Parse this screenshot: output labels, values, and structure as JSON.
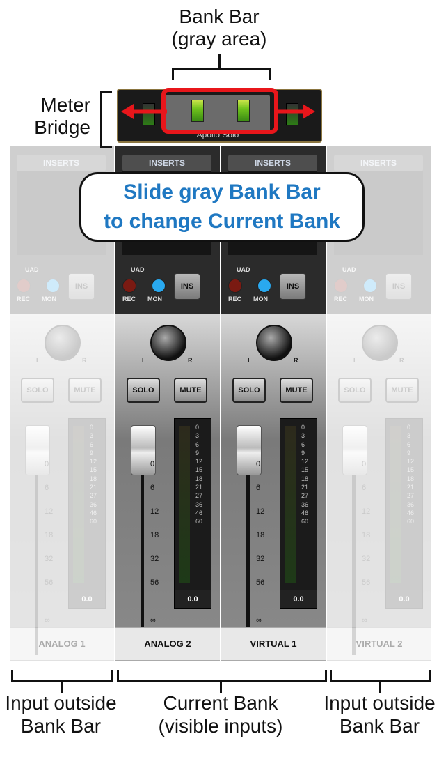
{
  "annotations": {
    "bank_bar_title": "Bank Bar",
    "bank_bar_subtitle": "(gray area)",
    "meter_bridge_line1": "Meter",
    "meter_bridge_line2": "Bridge",
    "callout_line1": "Slide gray Bank Bar",
    "callout_line2": "to change Current Bank",
    "outside_left_line1": "Input outside",
    "outside_left_line2": "Bank Bar",
    "current_bank_line1": "Current Bank",
    "current_bank_line2": "(visible inputs)",
    "outside_right_line1": "Input outside",
    "outside_right_line2": "Bank Bar"
  },
  "meter_bridge": {
    "label": "Apollo Solo"
  },
  "strip_common": {
    "inserts_label": "INSERTS",
    "uad_label": "UAD",
    "rec_label": "REC",
    "mon_label": "MON",
    "ins_label": "INS",
    "solo_label": "SOLO",
    "mute_label": "MUTE",
    "pan_l": "L",
    "pan_r": "R",
    "fader_scale": [
      "0",
      "6",
      "12",
      "18",
      "32",
      "56",
      "∞"
    ],
    "meter_scale": [
      "0",
      "3",
      "6",
      "9",
      "12",
      "15",
      "18",
      "21",
      "27",
      "36",
      "46",
      "60"
    ]
  },
  "channels": [
    {
      "name": "ANALOG 1",
      "value": "0.0",
      "in_bank": false
    },
    {
      "name": "ANALOG 2",
      "value": "0.0",
      "in_bank": true
    },
    {
      "name": "VIRTUAL 1",
      "value": "0.0",
      "in_bank": true
    },
    {
      "name": "VIRTUAL 2",
      "value": "0.0",
      "in_bank": false
    }
  ],
  "colors": {
    "highlight_red": "#e8161b",
    "callout_blue": "#1f78c2",
    "mon_blue": "#29a9f0",
    "meter_green": "#6fc21c"
  }
}
